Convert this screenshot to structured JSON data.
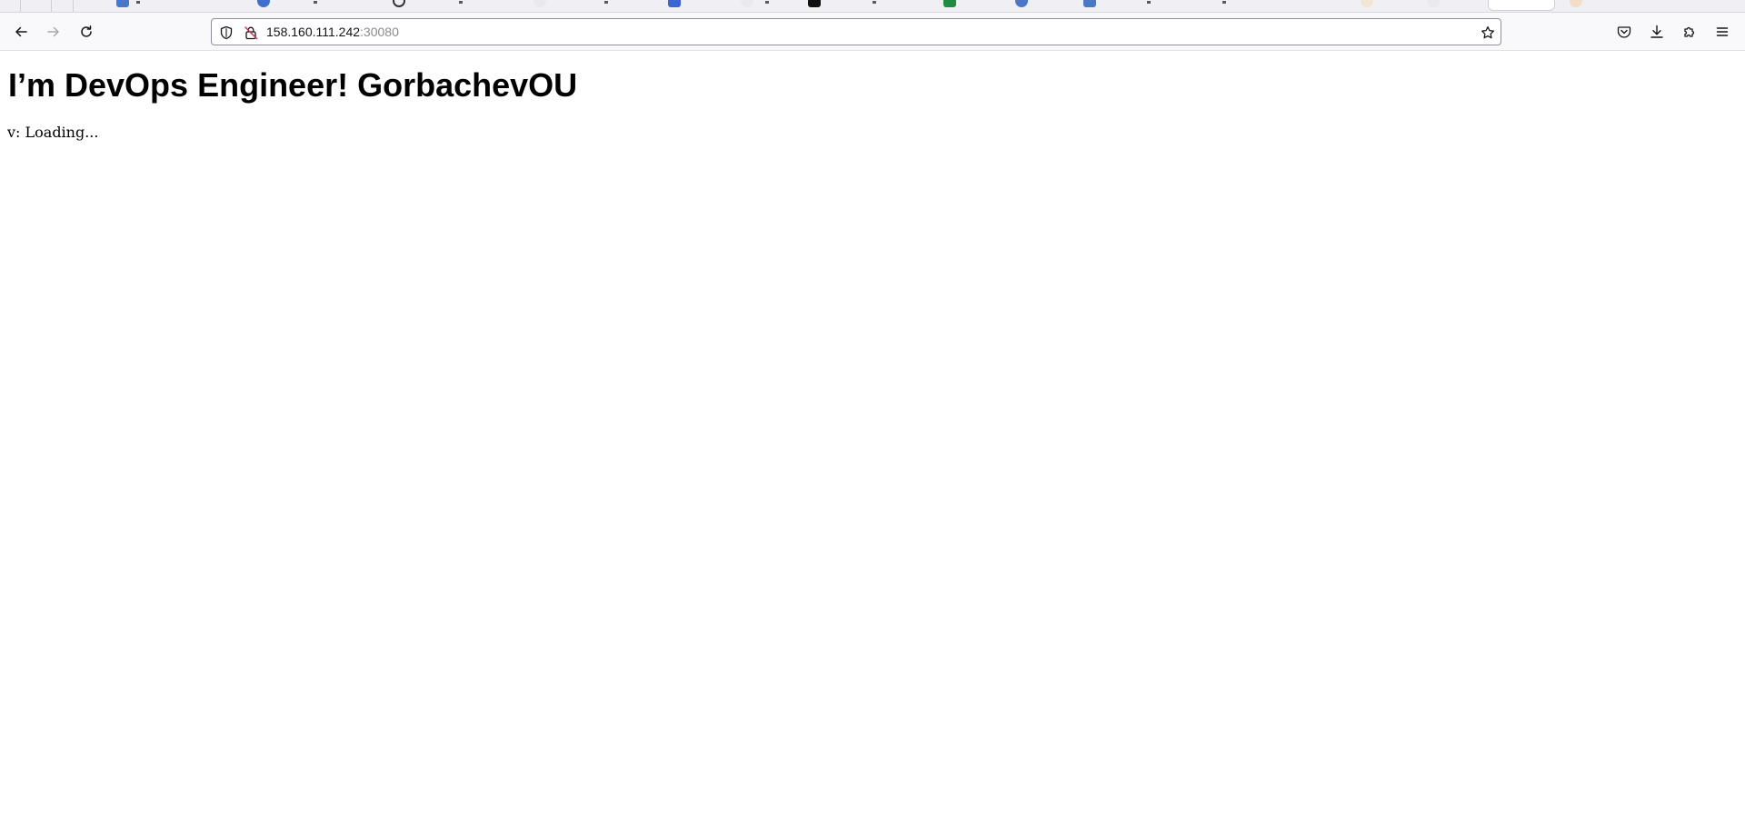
{
  "browser": {
    "address_bar": {
      "host": "158.160.111.242",
      "port": ":30080"
    },
    "icons": {
      "back": "arrow-left-icon",
      "forward": "arrow-right-icon",
      "reload": "reload-icon",
      "tracking_protection": "shield-icon",
      "connection": "insecure-lock-icon",
      "bookmark": "star-icon",
      "pocket": "pocket-icon",
      "downloads": "download-icon",
      "extensions": "puzzle-icon",
      "menu": "hamburger-menu-icon"
    },
    "colors": {
      "toolbar_bg": "#f9f9fb",
      "tabstrip_bg": "#f0f0f4",
      "port_text": "#8a8a92"
    }
  },
  "page": {
    "heading": "I’m DevOps Engineer! GorbachevOU",
    "version_text": "v: Loading..."
  }
}
